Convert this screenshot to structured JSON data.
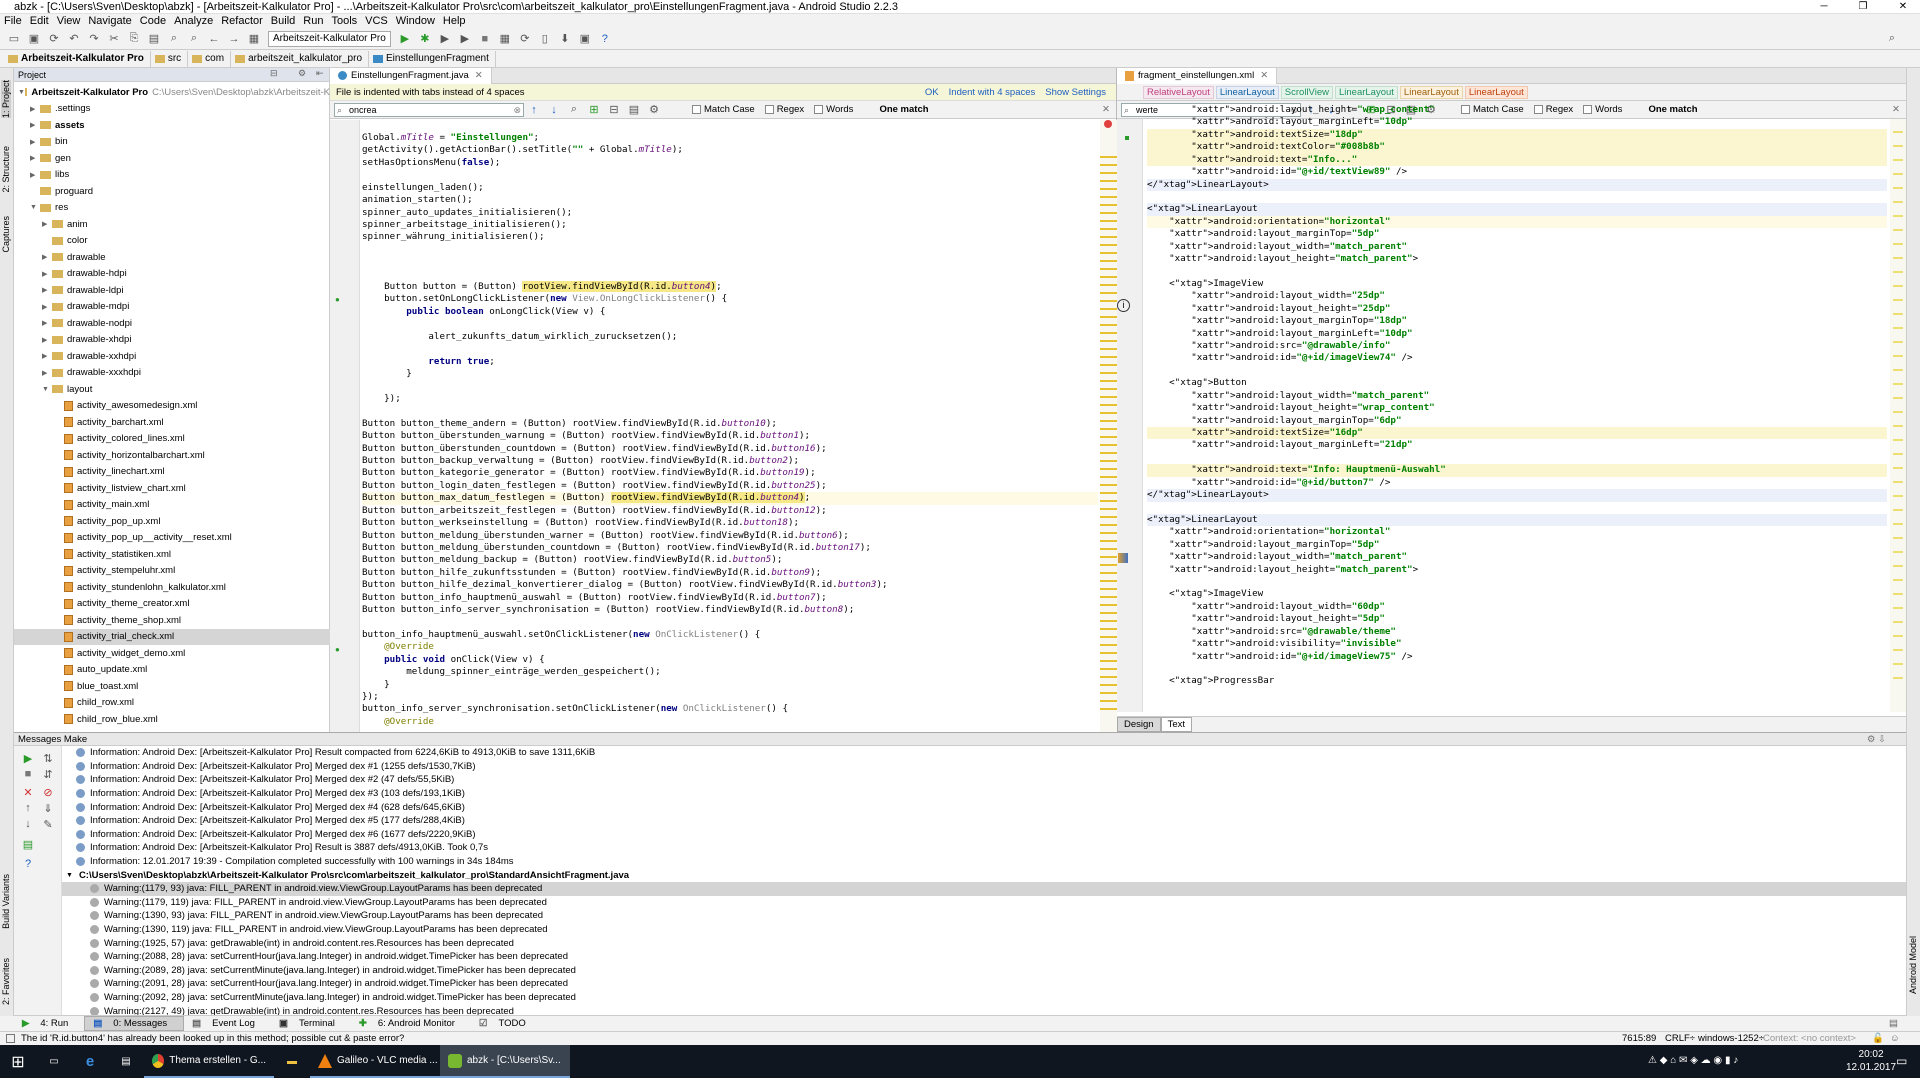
{
  "window": {
    "title": "abzk - [C:\\Users\\Sven\\Desktop\\abzk] - [Arbeitszeit-Kalkulator Pro] - ...\\Arbeitszeit-Kalkulator Pro\\src\\com\\arbeitszeit_kalkulator_pro\\EinstellungenFragment.java - Android Studio 2.2.3"
  },
  "menu": [
    "File",
    "Edit",
    "View",
    "Navigate",
    "Code",
    "Analyze",
    "Refactor",
    "Build",
    "Run",
    "Tools",
    "VCS",
    "Window",
    "Help"
  ],
  "toolbar": {
    "run_config": "Arbeitszeit-Kalkulator Pro"
  },
  "breadcrumb": [
    "Arbeitszeit-Kalkulator Pro",
    "src",
    "com",
    "arbeitszeit_kalkulator_pro",
    "EinstellungenFragment"
  ],
  "left_tool_tabs": [
    "1: Project",
    "2: Structure",
    "Captures",
    "Build Variants",
    "2: Favorites"
  ],
  "right_tool_tabs": [
    "Android Model"
  ],
  "project": {
    "header": "Project",
    "root": "Arbeitszeit-Kalkulator Pro",
    "root_path": "C:\\Users\\Sven\\Desktop\\abzk\\Arbeitszeit-K",
    "items": [
      {
        "label": ".settings",
        "depth": 1,
        "kind": "folder",
        "arrow": "▶"
      },
      {
        "label": "assets",
        "depth": 1,
        "kind": "folder",
        "arrow": "▶"
      },
      {
        "label": "bin",
        "depth": 1,
        "kind": "folder",
        "arrow": "▶"
      },
      {
        "label": "gen",
        "depth": 1,
        "kind": "folder",
        "arrow": "▶"
      },
      {
        "label": "libs",
        "depth": 1,
        "kind": "folder",
        "arrow": "▶"
      },
      {
        "label": "proguard",
        "depth": 1,
        "kind": "folder",
        "arrow": ""
      },
      {
        "label": "res",
        "depth": 1,
        "kind": "folder",
        "arrow": "▼"
      },
      {
        "label": "anim",
        "depth": 2,
        "kind": "folder",
        "arrow": "▶"
      },
      {
        "label": "color",
        "depth": 2,
        "kind": "folder",
        "arrow": ""
      },
      {
        "label": "drawable",
        "depth": 2,
        "kind": "folder",
        "arrow": "▶"
      },
      {
        "label": "drawable-hdpi",
        "depth": 2,
        "kind": "folder",
        "arrow": "▶"
      },
      {
        "label": "drawable-ldpi",
        "depth": 2,
        "kind": "folder",
        "arrow": "▶"
      },
      {
        "label": "drawable-mdpi",
        "depth": 2,
        "kind": "folder",
        "arrow": "▶"
      },
      {
        "label": "drawable-nodpi",
        "depth": 2,
        "kind": "folder",
        "arrow": "▶"
      },
      {
        "label": "drawable-xhdpi",
        "depth": 2,
        "kind": "folder",
        "arrow": "▶"
      },
      {
        "label": "drawable-xxhdpi",
        "depth": 2,
        "kind": "folder",
        "arrow": "▶"
      },
      {
        "label": "drawable-xxxhdpi",
        "depth": 2,
        "kind": "folder",
        "arrow": "▶"
      },
      {
        "label": "layout",
        "depth": 2,
        "kind": "folder",
        "arrow": "▼"
      },
      {
        "label": "activity_awesomedesign.xml",
        "depth": 3,
        "kind": "xml",
        "arrow": ""
      },
      {
        "label": "activity_barchart.xml",
        "depth": 3,
        "kind": "xml",
        "arrow": ""
      },
      {
        "label": "activity_colored_lines.xml",
        "depth": 3,
        "kind": "xml",
        "arrow": ""
      },
      {
        "label": "activity_horizontalbarchart.xml",
        "depth": 3,
        "kind": "xml",
        "arrow": ""
      },
      {
        "label": "activity_linechart.xml",
        "depth": 3,
        "kind": "xml",
        "arrow": ""
      },
      {
        "label": "activity_listview_chart.xml",
        "depth": 3,
        "kind": "xml",
        "arrow": ""
      },
      {
        "label": "activity_main.xml",
        "depth": 3,
        "kind": "xml",
        "arrow": ""
      },
      {
        "label": "activity_pop_up.xml",
        "depth": 3,
        "kind": "xml",
        "arrow": ""
      },
      {
        "label": "activity_pop_up__activity__reset.xml",
        "depth": 3,
        "kind": "xml",
        "arrow": ""
      },
      {
        "label": "activity_statistiken.xml",
        "depth": 3,
        "kind": "xml",
        "arrow": ""
      },
      {
        "label": "activity_stempeluhr.xml",
        "depth": 3,
        "kind": "xml",
        "arrow": ""
      },
      {
        "label": "activity_stundenlohn_kalkulator.xml",
        "depth": 3,
        "kind": "xml",
        "arrow": ""
      },
      {
        "label": "activity_theme_creator.xml",
        "depth": 3,
        "kind": "xml",
        "arrow": ""
      },
      {
        "label": "activity_theme_shop.xml",
        "depth": 3,
        "kind": "xml",
        "arrow": ""
      },
      {
        "label": "activity_trial_check.xml",
        "depth": 3,
        "kind": "xml",
        "arrow": "",
        "selected": true
      },
      {
        "label": "activity_widget_demo.xml",
        "depth": 3,
        "kind": "xml",
        "arrow": ""
      },
      {
        "label": "auto_update.xml",
        "depth": 3,
        "kind": "xml",
        "arrow": ""
      },
      {
        "label": "blue_toast.xml",
        "depth": 3,
        "kind": "xml",
        "arrow": ""
      },
      {
        "label": "child_row.xml",
        "depth": 3,
        "kind": "xml",
        "arrow": ""
      },
      {
        "label": "child_row_blue.xml",
        "depth": 3,
        "kind": "xml",
        "arrow": ""
      }
    ]
  },
  "editor_left": {
    "tab": "EinstellungenFragment.java",
    "notice": "File is indented with tabs instead of 4 spaces",
    "notice_actions": [
      "OK",
      "Indent with 4 spaces",
      "Show Settings"
    ],
    "search_value": "oncrea",
    "options": [
      "Match Case",
      "Regex",
      "Words"
    ],
    "match_text": "One match",
    "code": [
      "Global.mTitle = \"Einstellungen\";",
      "getActivity().getActionBar().setTitle(\"\" + Global.mTitle);",
      "setHasOptionsMenu(false);",
      "",
      "einstellungen_laden();",
      "animation_starten();",
      "spinner_auto_updates_initialisieren();",
      "spinner_arbeitstage_initialisieren();",
      "spinner_währung_initialisieren();",
      "",
      "",
      "",
      "    Button button = (Button) rootView.findViewById(R.id.button4);",
      "    button.setOnLongClickListener(new View.OnLongClickListener() {",
      "        public boolean onLongClick(View v) {",
      "",
      "            alert_zukunfts_datum_wirklich_zurucksetzen();",
      "",
      "            return true;",
      "        }",
      "",
      "    });",
      "",
      "Button button_theme_andern = (Button) rootView.findViewById(R.id.button10);",
      "Button button_überstunden_warnung = (Button) rootView.findViewById(R.id.button1);",
      "Button button_überstunden_countdown = (Button) rootView.findViewById(R.id.button16);",
      "Button button_backup_verwaltung = (Button) rootView.findViewById(R.id.button2);",
      "Button button_kategorie_generator = (Button) rootView.findViewById(R.id.button19);",
      "Button button_login_daten_festlegen = (Button) rootView.findViewById(R.id.button25);",
      "Button button_max_datum_festlegen = (Button) rootView.findViewById(R.id.button4);",
      "Button button_arbeitszeit_festlegen = (Button) rootView.findViewById(R.id.button12);",
      "Button button_werkseinstellung = (Button) rootView.findViewById(R.id.button18);",
      "Button button_meldung_überstunden_warner = (Button) rootView.findViewById(R.id.button6);",
      "Button button_meldung_überstunden_countdown = (Button) rootView.findViewById(R.id.button17);",
      "Button button_meldung_backup = (Button) rootView.findViewById(R.id.button5);",
      "Button button_hilfe_zukunftsstunden = (Button) rootView.findViewById(R.id.button9);",
      "Button button_hilfe_dezimal_konvertierer_dialog = (Button) rootView.findViewById(R.id.button3);",
      "Button button_info_hauptmenü_auswahl = (Button) rootView.findViewById(R.id.button7);",
      "Button button_info_server_synchronisation = (Button) rootView.findViewById(R.id.button8);",
      "",
      "button_info_hauptmenü_auswahl.setOnClickListener(new OnClickListener() {",
      "    @Override",
      "    public void onClick(View v) {",
      "        meldung_spinner_einträge_werden_gespeichert();",
      "    }",
      "});",
      "button_info_server_synchronisation.setOnClickListener(new OnClickListener() {",
      "    @Override"
    ]
  },
  "editor_right": {
    "tab": "fragment_einstellungen.xml",
    "breadcrumbs": [
      "RelativeLayout",
      "LinearLayout",
      "ScrollView",
      "LinearLayout",
      "LinearLayout",
      "LinearLayout"
    ],
    "search_value": "werte",
    "options": [
      "Match Case",
      "Regex",
      "Words"
    ],
    "match_text": "One match",
    "bottom_tabs": [
      "Design",
      "Text"
    ],
    "code": [
      "        android:layout_height=\"wrap_content\"",
      "        android:layout_marginLeft=\"10dp\"",
      "        android:textSize=\"18dp\"",
      "        android:textColor=\"#008b8b\"",
      "        android:text=\"Info...\"",
      "        android:id=\"@+id/textView89\" />",
      "</LinearLayout>",
      "",
      "<LinearLayout",
      "    android:orientation=\"horizontal\"",
      "    android:layout_marginTop=\"5dp\"",
      "    android:layout_width=\"match_parent\"",
      "    android:layout_height=\"match_parent\">",
      "",
      "    <ImageView",
      "        android:layout_width=\"25dp\"",
      "        android:layout_height=\"25dp\"",
      "        android:layout_marginTop=\"18dp\"",
      "        android:layout_marginLeft=\"10dp\"",
      "        android:src=\"@drawable/info\"",
      "        android:id=\"@+id/imageView74\" />",
      "",
      "    <Button",
      "        android:layout_width=\"match_parent\"",
      "        android:layout_height=\"wrap_content\"",
      "        android:layout_marginTop=\"6dp\"",
      "        android:textSize=\"16dp\"",
      "        android:layout_marginLeft=\"21dp\"",
      "",
      "        android:text=\"Info: Hauptmenü-Auswahl\"",
      "        android:id=\"@+id/button7\" />",
      "</LinearLayout>",
      "",
      "<LinearLayout",
      "    android:orientation=\"horizontal\"",
      "    android:layout_marginTop=\"5dp\"",
      "    android:layout_width=\"match_parent\"",
      "    android:layout_height=\"match_parent\">",
      "",
      "    <ImageView",
      "        android:layout_width=\"60dp\"",
      "        android:layout_height=\"5dp\"",
      "        android:src=\"@drawable/theme\"",
      "        android:visibility=\"invisible\"",
      "        android:id=\"@+id/imageView75\" />",
      "",
      "    <ProgressBar"
    ]
  },
  "messages": {
    "header": "Messages Make",
    "lines": [
      {
        "type": "info",
        "text": "Information: Android Dex: [Arbeitszeit-Kalkulator Pro] Result compacted from 6224,6KiB to 4913,0KiB to save 1311,6KiB",
        "indent": 0
      },
      {
        "type": "info",
        "text": "Information: Android Dex: [Arbeitszeit-Kalkulator Pro] Merged dex #1 (1255 defs/1530,7KiB)",
        "indent": 0
      },
      {
        "type": "info",
        "text": "Information: Android Dex: [Arbeitszeit-Kalkulator Pro] Merged dex #2 (47 defs/55,5KiB)",
        "indent": 0
      },
      {
        "type": "info",
        "text": "Information: Android Dex: [Arbeitszeit-Kalkulator Pro] Merged dex #3 (103 defs/193,1KiB)",
        "indent": 0
      },
      {
        "type": "info",
        "text": "Information: Android Dex: [Arbeitszeit-Kalkulator Pro] Merged dex #4 (628 defs/645,6KiB)",
        "indent": 0
      },
      {
        "type": "info",
        "text": "Information: Android Dex: [Arbeitszeit-Kalkulator Pro] Merged dex #5 (177 defs/288,4KiB)",
        "indent": 0
      },
      {
        "type": "info",
        "text": "Information: Android Dex: [Arbeitszeit-Kalkulator Pro] Merged dex #6 (1677 defs/2220,9KiB)",
        "indent": 0
      },
      {
        "type": "info",
        "text": "Information: Android Dex: [Arbeitszeit-Kalkulator Pro] Result is 3887 defs/4913,0KiB. Took 0,7s",
        "indent": 0
      },
      {
        "type": "info",
        "text": "Information: 12.01.2017 19:39 - Compilation completed successfully with 100 warnings in 34s 184ms",
        "indent": 0
      },
      {
        "type": "file",
        "text": "C:\\Users\\Sven\\Desktop\\abzk\\Arbeitszeit-Kalkulator Pro\\src\\com\\arbeitszeit_kalkulator_pro\\StandardAnsichtFragment.java",
        "indent": 0
      },
      {
        "type": "warn",
        "text": "Warning:(1179, 93)  java: FILL_PARENT in android.view.ViewGroup.LayoutParams has been deprecated",
        "indent": 1,
        "selected": true
      },
      {
        "type": "warn",
        "text": "Warning:(1179, 119)  java: FILL_PARENT in android.view.ViewGroup.LayoutParams has been deprecated",
        "indent": 1
      },
      {
        "type": "warn",
        "text": "Warning:(1390, 93)  java: FILL_PARENT in android.view.ViewGroup.LayoutParams has been deprecated",
        "indent": 1
      },
      {
        "type": "warn",
        "text": "Warning:(1390, 119)  java: FILL_PARENT in android.view.ViewGroup.LayoutParams has been deprecated",
        "indent": 1
      },
      {
        "type": "warn",
        "text": "Warning:(1925, 57)  java: getDrawable(int) in android.content.res.Resources has been deprecated",
        "indent": 1
      },
      {
        "type": "warn",
        "text": "Warning:(2088, 28)  java: setCurrentHour(java.lang.Integer) in android.widget.TimePicker has been deprecated",
        "indent": 1
      },
      {
        "type": "warn",
        "text": "Warning:(2089, 28)  java: setCurrentMinute(java.lang.Integer) in android.widget.TimePicker has been deprecated",
        "indent": 1
      },
      {
        "type": "warn",
        "text": "Warning:(2091, 28)  java: setCurrentHour(java.lang.Integer) in android.widget.TimePicker has been deprecated",
        "indent": 1
      },
      {
        "type": "warn",
        "text": "Warning:(2092, 28)  java: setCurrentMinute(java.lang.Integer) in android.widget.TimePicker has been deprecated",
        "indent": 1
      },
      {
        "type": "warn",
        "text": "Warning:(2127, 49)  java: getDrawable(int) in android.content.res.Resources has been deprecated",
        "indent": 1
      }
    ]
  },
  "bottom_tabs": [
    "4: Run",
    "0: Messages",
    "Event Log",
    "Terminal",
    "6: Android Monitor",
    "TODO"
  ],
  "status": {
    "message": "The id 'R.id.button4' has already been looked up in this method; possible cut & paste error?",
    "position": "7615:89",
    "line_sep": "CRLF÷",
    "encoding": "windows-1252÷",
    "context": "Context: <no context>"
  },
  "taskbar": {
    "apps": [
      "Thema erstellen - G...",
      "Galileo - VLC media ...",
      "abzk - [C:\\Users\\Sv..."
    ],
    "time": "20:02",
    "date": "12.01.2017"
  }
}
